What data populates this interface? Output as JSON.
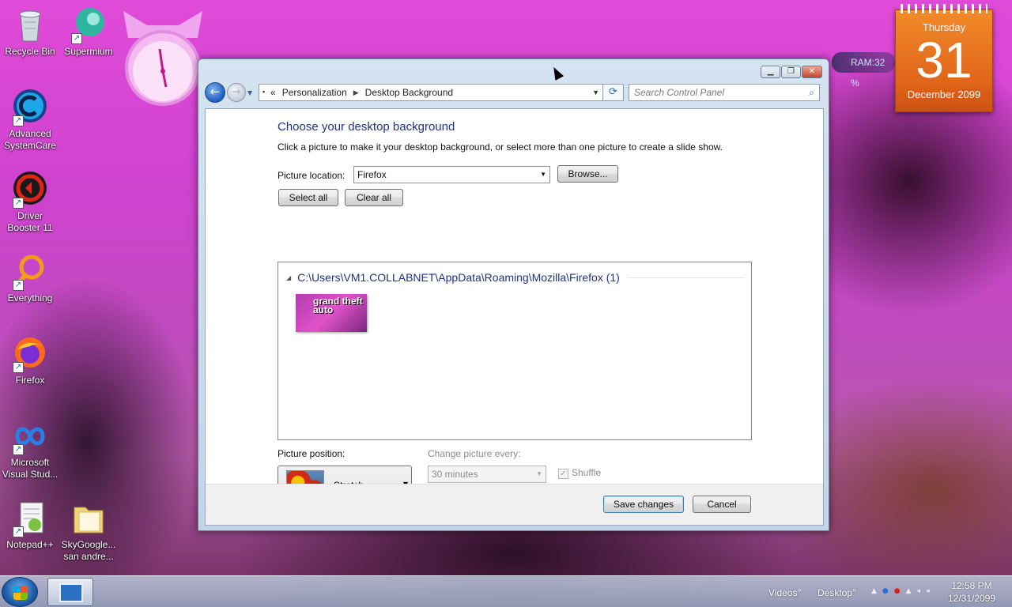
{
  "desktop": {
    "icons": [
      {
        "label": "Recycle Bin",
        "icon": "recycle-bin-icon"
      },
      {
        "label": "Supermium",
        "icon": "supermium-icon"
      },
      {
        "label": "Advanced SystemCare",
        "icon": "advanced-systemcare-icon"
      },
      {
        "label": "Driver Booster 11",
        "icon": "driver-booster-icon"
      },
      {
        "label": "Everything",
        "icon": "everything-search-icon"
      },
      {
        "label": "Firefox",
        "icon": "firefox-icon"
      },
      {
        "label": "Microsoft Visual Stud...",
        "icon": "visual-studio-icon"
      },
      {
        "label": "Notepad++",
        "icon": "notepad-plus-plus-icon"
      },
      {
        "label": "SkyGoogle... san andre...",
        "icon": "folder-icon"
      }
    ]
  },
  "gadgets": {
    "ram": "RAM:32 %",
    "calendar": {
      "weekday": "Thursday",
      "day": "31",
      "month_year": "December 2099"
    }
  },
  "window": {
    "breadcrumb": {
      "overflow": "«",
      "items": [
        "Personalization",
        "Desktop Background"
      ]
    },
    "search_placeholder": "Search Control Panel",
    "title": "Choose your desktop background",
    "subtitle": "Click a picture to make it your desktop background, or select more than one picture to create a slide show.",
    "picture_location_label": "Picture location:",
    "picture_location_value": "Firefox",
    "browse_label": "Browse...",
    "select_all_label": "Select all",
    "clear_all_label": "Clear all",
    "group_header": "C:\\Users\\VM1.COLLABNET\\AppData\\Roaming\\Mozilla\\Firefox (1)",
    "thumbnail_text": "grand theft auto",
    "picture_position_label": "Picture position:",
    "picture_position_value": "Stretch",
    "change_every_label": "Change picture every:",
    "change_every_value": "30 minutes",
    "shuffle_label": "Shuffle",
    "save_label": "Save changes",
    "cancel_label": "Cancel"
  },
  "taskbar": {
    "links": [
      "Videos",
      "Desktop"
    ],
    "time": "12:58 PM",
    "date": "12/31/2099"
  }
}
